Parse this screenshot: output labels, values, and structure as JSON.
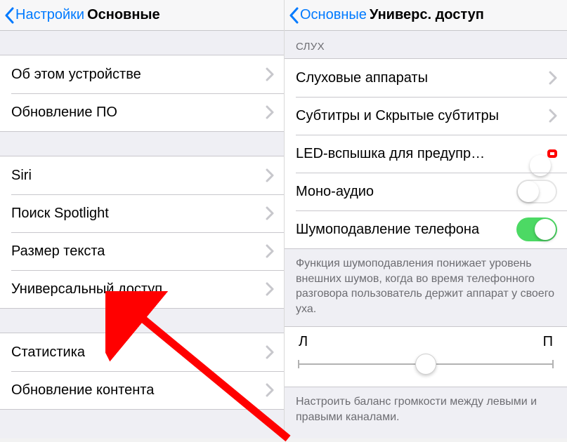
{
  "left": {
    "back": "Настройки",
    "title": "Основные",
    "groups": [
      {
        "rows": [
          {
            "label": "Об этом устройстве",
            "type": "link"
          },
          {
            "label": "Обновление ПО",
            "type": "link"
          }
        ]
      },
      {
        "rows": [
          {
            "label": "Siri",
            "type": "link"
          },
          {
            "label": "Поиск Spotlight",
            "type": "link"
          },
          {
            "label": "Размер текста",
            "type": "link"
          },
          {
            "label": "Универсальный доступ",
            "type": "link"
          }
        ]
      },
      {
        "rows": [
          {
            "label": "Статистика",
            "type": "link"
          },
          {
            "label": "Обновление контента",
            "type": "link"
          }
        ]
      }
    ]
  },
  "right": {
    "back": "Основные",
    "title": "Универс. доступ",
    "section_header": "СЛУХ",
    "rows": [
      {
        "label": "Слуховые аппараты",
        "type": "link"
      },
      {
        "label": "Субтитры и Скрытые субтитры",
        "type": "link"
      },
      {
        "label": "LED-вспышка для предупр…",
        "type": "switch",
        "on": true,
        "highlight": true
      },
      {
        "label": "Моно-аудио",
        "type": "switch",
        "on": false
      },
      {
        "label": "Шумоподавление телефона",
        "type": "switch",
        "on": true
      }
    ],
    "noise_footer": "Функция шумоподавления понижает уровень внешних шумов, когда во время телефонного разговора пользователь держит аппарат у своего уха.",
    "slider": {
      "left": "Л",
      "right": "П",
      "value": 0.5
    },
    "balance_footer": "Настроить баланс громкости между левыми и правыми каналами."
  },
  "colors": {
    "accent": "#007aff",
    "switch_on": "#4cd964",
    "highlight": "#ff0000"
  }
}
